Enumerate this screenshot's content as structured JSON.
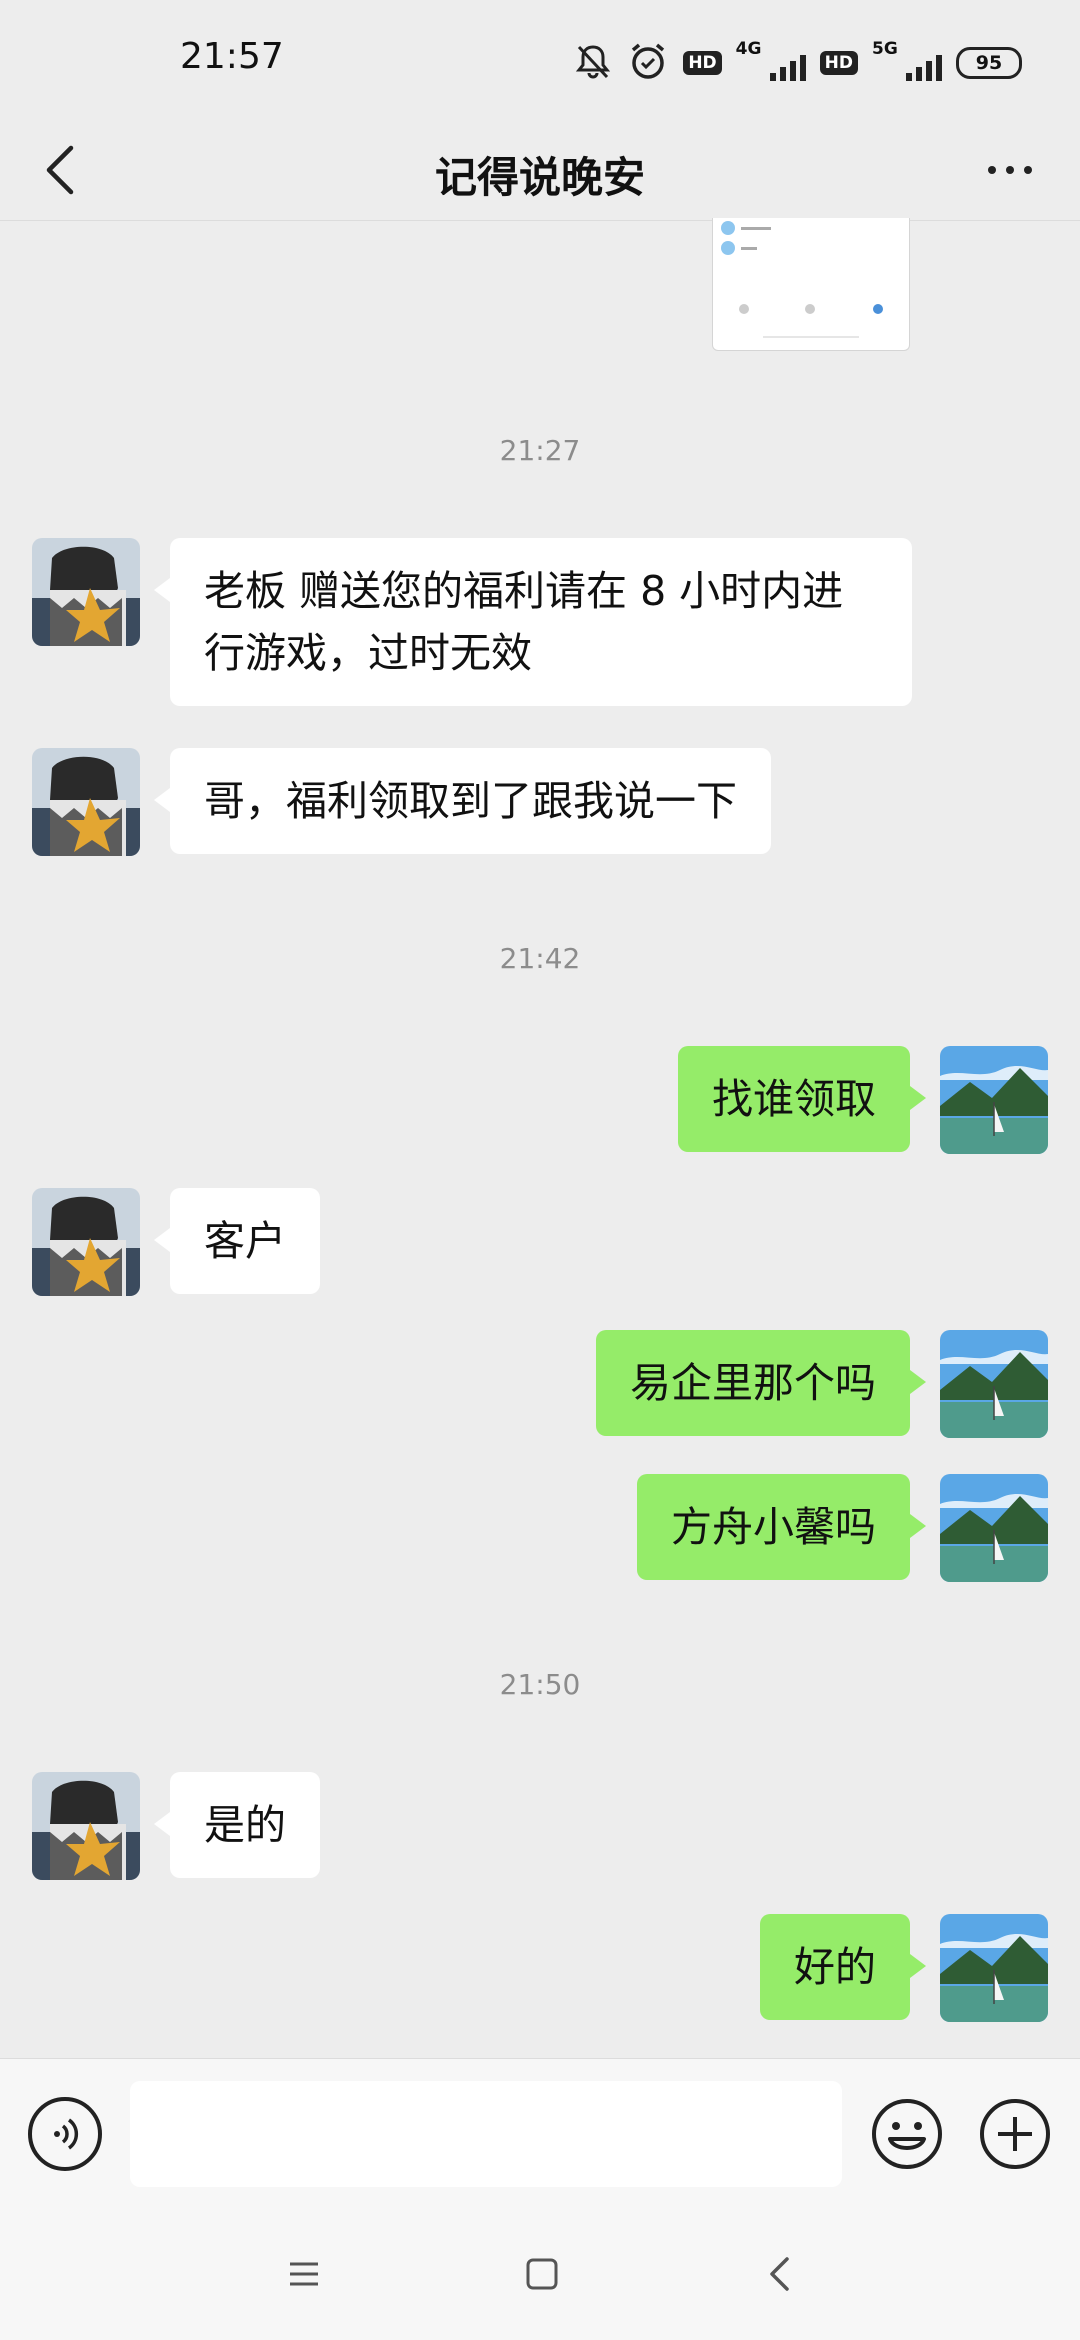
{
  "status_bar": {
    "time": "21:57",
    "network_1": "4G",
    "network_2": "5G",
    "hd_label": "HD",
    "battery": "95",
    "icons": [
      "mute-bell-icon",
      "alarm-icon",
      "hd-icon",
      "signal-4g-icon",
      "hd-icon",
      "signal-5g-icon",
      "battery-icon"
    ]
  },
  "nav": {
    "title": "记得说晚安",
    "back_icon": "chevron-left-icon",
    "more_icon": "more-dots-icon"
  },
  "chat": {
    "timestamps": [
      "21:27",
      "21:42",
      "21:50"
    ],
    "messages": [
      {
        "side": "in",
        "text": "老板 赠送您的福利请在 8 小时内进行游戏，过时无效"
      },
      {
        "side": "in",
        "text": "哥，福利领取到了跟我说一下"
      },
      {
        "side": "out",
        "text": "找谁领取"
      },
      {
        "side": "in",
        "text": "客户"
      },
      {
        "side": "out",
        "text": "易企里那个吗"
      },
      {
        "side": "out",
        "text": "方舟小馨吗"
      },
      {
        "side": "in",
        "text": "是的"
      },
      {
        "side": "out",
        "text": "好的"
      }
    ]
  },
  "input_bar": {
    "value": "",
    "placeholder": "",
    "icons": [
      "voice-icon",
      "emoji-icon",
      "plus-icon"
    ]
  },
  "system_nav": {
    "icons": [
      "menu-icon",
      "home-icon",
      "back-icon"
    ]
  },
  "colors": {
    "background": "#ededed",
    "outgoing_bubble": "#95ec69",
    "incoming_bubble": "#ffffff",
    "timestamp_text": "#8c8c8c"
  }
}
